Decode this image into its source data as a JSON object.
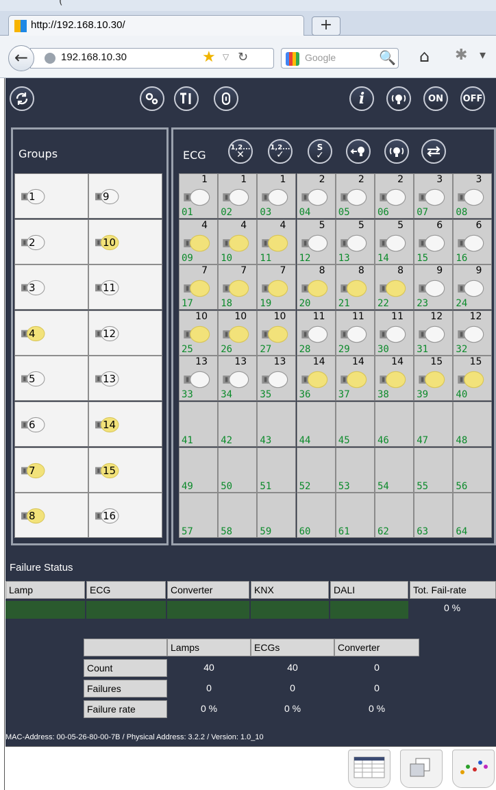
{
  "browser": {
    "top_fragment": "(",
    "tab_title": "http://192.168.10.30/",
    "newtab_label": "+",
    "address": "192.168.10.30",
    "search_placeholder": "Google"
  },
  "toolbar": {
    "ecg_label": "ECG",
    "badge_12x": "1,2...",
    "badge_s": "S",
    "on_label": "ON",
    "off_label": "OFF",
    "info_label": "i"
  },
  "groups": {
    "title": "Groups",
    "items": [
      {
        "num": "1",
        "lit": false
      },
      {
        "num": "9",
        "lit": false
      },
      {
        "num": "2",
        "lit": false
      },
      {
        "num": "10",
        "lit": true
      },
      {
        "num": "3",
        "lit": false
      },
      {
        "num": "11",
        "lit": false
      },
      {
        "num": "4",
        "lit": true
      },
      {
        "num": "12",
        "lit": false
      },
      {
        "num": "5",
        "lit": false
      },
      {
        "num": "13",
        "lit": false
      },
      {
        "num": "6",
        "lit": false
      },
      {
        "num": "14",
        "lit": true
      },
      {
        "num": "7",
        "lit": true
      },
      {
        "num": "15",
        "lit": true
      },
      {
        "num": "8",
        "lit": true
      },
      {
        "num": "16",
        "lit": false
      }
    ]
  },
  "ecg": {
    "cells": [
      {
        "addr": "01",
        "group": "1",
        "lit": false
      },
      {
        "addr": "02",
        "group": "1",
        "lit": false
      },
      {
        "addr": "03",
        "group": "1",
        "lit": false
      },
      {
        "addr": "04",
        "group": "2",
        "lit": false
      },
      {
        "addr": "05",
        "group": "2",
        "lit": false
      },
      {
        "addr": "06",
        "group": "2",
        "lit": false
      },
      {
        "addr": "07",
        "group": "3",
        "lit": false
      },
      {
        "addr": "08",
        "group": "3",
        "lit": false
      },
      {
        "addr": "09",
        "group": "4",
        "lit": true
      },
      {
        "addr": "10",
        "group": "4",
        "lit": true
      },
      {
        "addr": "11",
        "group": "4",
        "lit": true
      },
      {
        "addr": "12",
        "group": "5",
        "lit": false
      },
      {
        "addr": "13",
        "group": "5",
        "lit": false
      },
      {
        "addr": "14",
        "group": "5",
        "lit": false
      },
      {
        "addr": "15",
        "group": "6",
        "lit": false
      },
      {
        "addr": "16",
        "group": "6",
        "lit": false
      },
      {
        "addr": "17",
        "group": "7",
        "lit": true
      },
      {
        "addr": "18",
        "group": "7",
        "lit": true
      },
      {
        "addr": "19",
        "group": "7",
        "lit": true
      },
      {
        "addr": "20",
        "group": "8",
        "lit": true
      },
      {
        "addr": "21",
        "group": "8",
        "lit": true
      },
      {
        "addr": "22",
        "group": "8",
        "lit": true
      },
      {
        "addr": "23",
        "group": "9",
        "lit": false
      },
      {
        "addr": "24",
        "group": "9",
        "lit": false
      },
      {
        "addr": "25",
        "group": "10",
        "lit": true
      },
      {
        "addr": "26",
        "group": "10",
        "lit": true
      },
      {
        "addr": "27",
        "group": "10",
        "lit": true
      },
      {
        "addr": "28",
        "group": "11",
        "lit": false
      },
      {
        "addr": "29",
        "group": "11",
        "lit": false
      },
      {
        "addr": "30",
        "group": "11",
        "lit": false
      },
      {
        "addr": "31",
        "group": "12",
        "lit": false
      },
      {
        "addr": "32",
        "group": "12",
        "lit": false
      },
      {
        "addr": "33",
        "group": "13",
        "lit": false
      },
      {
        "addr": "34",
        "group": "13",
        "lit": false
      },
      {
        "addr": "35",
        "group": "13",
        "lit": false
      },
      {
        "addr": "36",
        "group": "14",
        "lit": true
      },
      {
        "addr": "37",
        "group": "14",
        "lit": true
      },
      {
        "addr": "38",
        "group": "14",
        "lit": true
      },
      {
        "addr": "39",
        "group": "15",
        "lit": true
      },
      {
        "addr": "40",
        "group": "15",
        "lit": true
      },
      {
        "addr": "41"
      },
      {
        "addr": "42"
      },
      {
        "addr": "43"
      },
      {
        "addr": "44"
      },
      {
        "addr": "45"
      },
      {
        "addr": "46"
      },
      {
        "addr": "47"
      },
      {
        "addr": "48"
      },
      {
        "addr": "49"
      },
      {
        "addr": "50"
      },
      {
        "addr": "51"
      },
      {
        "addr": "52"
      },
      {
        "addr": "53"
      },
      {
        "addr": "54"
      },
      {
        "addr": "55"
      },
      {
        "addr": "56"
      },
      {
        "addr": "57"
      },
      {
        "addr": "58"
      },
      {
        "addr": "59"
      },
      {
        "addr": "60"
      },
      {
        "addr": "61"
      },
      {
        "addr": "62"
      },
      {
        "addr": "63"
      },
      {
        "addr": "64"
      }
    ]
  },
  "failure": {
    "title": "Failure Status",
    "headers": [
      "Lamp",
      "ECG",
      "Converter",
      "KNX",
      "DALI",
      "Tot. Fail-rate"
    ],
    "total_rate": "0 %"
  },
  "stats": {
    "columns": [
      "Lamps",
      "ECGs",
      "Converter"
    ],
    "rows": [
      {
        "label": "Count",
        "values": [
          "40",
          "40",
          "0"
        ]
      },
      {
        "label": "Failures",
        "values": [
          "0",
          "0",
          "0"
        ]
      },
      {
        "label": "Failure rate",
        "values": [
          "0 %",
          "0 %",
          "0 %"
        ]
      }
    ]
  },
  "footer": {
    "text": "MAC-Address: 00-05-26-80-00-7B / Physical Address: 3.2.2 / Version: 1.0_10"
  },
  "colors": {
    "background": "#2d3446",
    "lamp_on": "#f2e27a",
    "address_text": "#0b8a2a",
    "failure_ok": "#2a5a2e"
  }
}
